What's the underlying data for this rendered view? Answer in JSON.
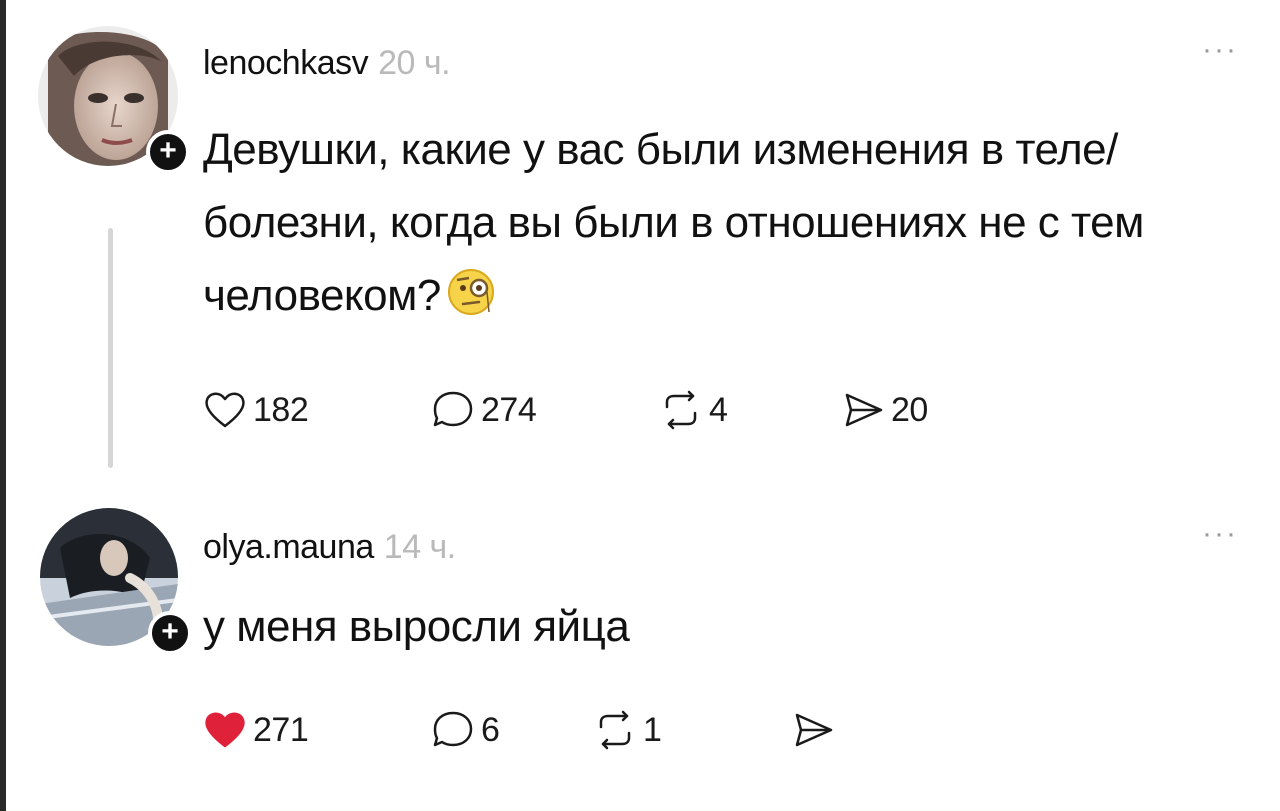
{
  "posts": [
    {
      "username": "lenochkasv",
      "time": "20 ч.",
      "text": "Девушки, какие у вас были изменения в теле/болезни, когда вы были в отношениях не с тем человеком?",
      "emoji": "face-with-monocle",
      "liked": false,
      "counts": {
        "likes": "182",
        "replies": "274",
        "reposts": "4",
        "shares": "20"
      }
    },
    {
      "username": "olya.mauna",
      "time": "14 ч.",
      "text": "у меня выросли яйца",
      "liked": true,
      "counts": {
        "likes": "271",
        "replies": "6",
        "reposts": "1",
        "shares": ""
      }
    }
  ],
  "ui": {
    "more": "···",
    "follow": "+"
  },
  "colors": {
    "text": "#111111",
    "muted": "#b9b9b9",
    "like_active": "#e0213a",
    "icon": "#1a1a1a",
    "thread_line": "#d6d6d6"
  }
}
